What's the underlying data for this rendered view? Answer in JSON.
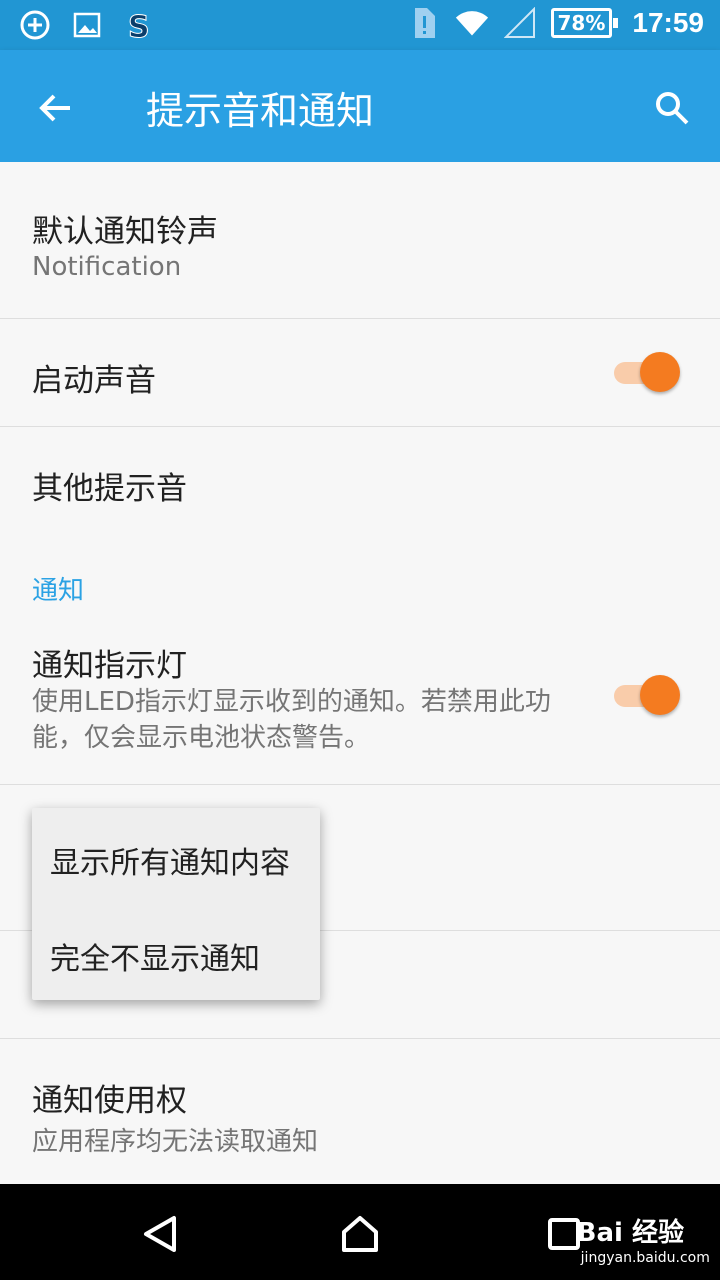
{
  "status_bar": {
    "battery": "78%",
    "time": "17:59",
    "colors": {
      "background": "#2196d3"
    }
  },
  "app_bar": {
    "title": "提示音和通知",
    "back_icon": "arrow-back-icon",
    "search_icon": "search-icon",
    "color": "#2aa0e3"
  },
  "settings": {
    "default_ringtone": {
      "title": "默认通知铃声",
      "value": "Notification"
    },
    "boot_sound": {
      "title": "启动声音",
      "enabled": true
    },
    "other_sounds": {
      "title": "其他提示音"
    },
    "notification_section": {
      "header": "通知"
    },
    "notification_light": {
      "title": "通知指示灯",
      "description": "使用LED指示灯显示收到的通知。若禁用此功能，仅会显示电池状态警告。",
      "enabled": true
    },
    "notification_access": {
      "title": "通知使用权",
      "value": "应用程序均无法读取通知"
    }
  },
  "popup_menu": {
    "options": [
      "显示所有通知内容",
      "完全不显示通知"
    ]
  },
  "nav_bar": {
    "back_icon": "nav-back-icon",
    "home_icon": "nav-home-icon",
    "recents_icon": "nav-recents-icon"
  },
  "watermark": {
    "main": "Bai 经验",
    "sub": "jingyan.baidu.com"
  },
  "accent_colors": {
    "switch_on": "#f47b20",
    "section_header": "#2ba2e4"
  }
}
